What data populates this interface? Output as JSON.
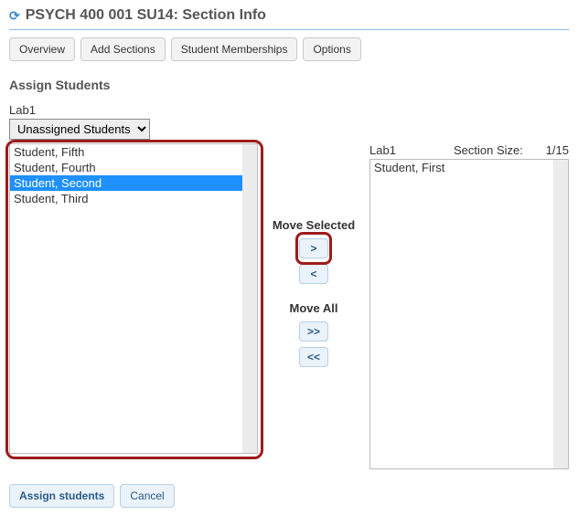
{
  "page_title": "PSYCH 400 001 SU14: Section Info",
  "tabs": {
    "overview": "Overview",
    "add_sections": "Add Sections",
    "student_memberships": "Student Memberships",
    "options": "Options"
  },
  "assign_heading": "Assign Students",
  "left": {
    "section_label": "Lab1",
    "dropdown_selected": "Unassigned Students",
    "items": [
      {
        "name": "Student, Fifth",
        "selected": false
      },
      {
        "name": "Student, Fourth",
        "selected": false
      },
      {
        "name": "Student, Second",
        "selected": true
      },
      {
        "name": "Student, Third",
        "selected": false
      }
    ]
  },
  "controls": {
    "move_selected_label": "Move Selected",
    "move_right": ">",
    "move_left": "<",
    "move_all_label": "Move All",
    "move_all_right": ">>",
    "move_all_left": "<<"
  },
  "right": {
    "section_label": "Lab1",
    "size_label": "Section Size:",
    "size_value": "1/15",
    "items": [
      {
        "name": "Student, First"
      }
    ]
  },
  "footer": {
    "assign": "Assign students",
    "cancel": "Cancel"
  }
}
